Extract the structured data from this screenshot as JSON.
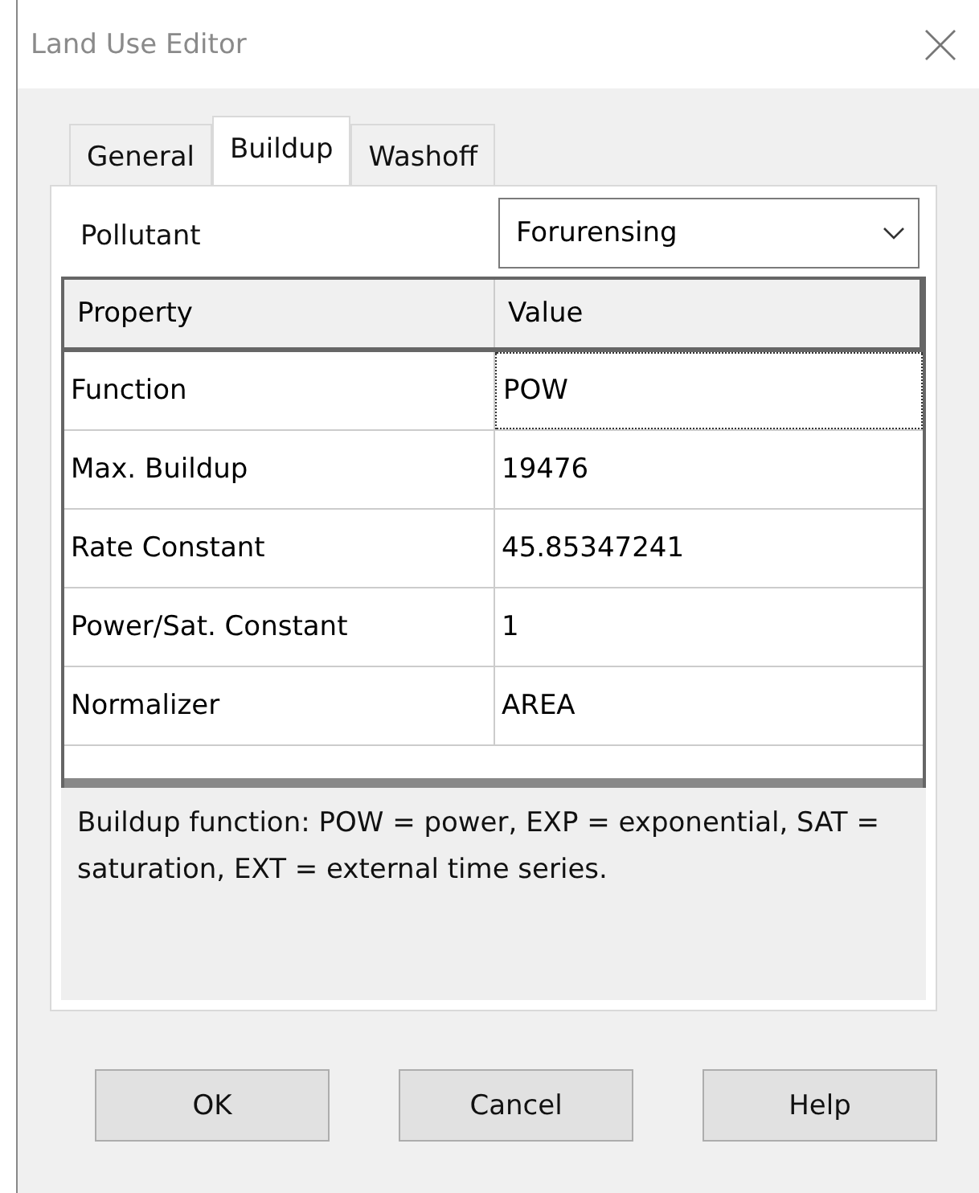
{
  "window": {
    "title": "Land Use Editor"
  },
  "tabs": [
    {
      "label": "General",
      "selected": false
    },
    {
      "label": "Buildup",
      "selected": true
    },
    {
      "label": "Washoff",
      "selected": false
    }
  ],
  "pollutant": {
    "label": "Pollutant",
    "value": "Forurensing"
  },
  "table": {
    "columns": [
      "Property",
      "Value"
    ],
    "rows": [
      {
        "property": "Function",
        "value": "POW",
        "focused": true
      },
      {
        "property": "Max. Buildup",
        "value": "19476",
        "focused": false
      },
      {
        "property": "Rate Constant",
        "value": "45.85347241",
        "focused": false
      },
      {
        "property": "Power/Sat. Constant",
        "value": "1",
        "focused": false
      },
      {
        "property": "Normalizer",
        "value": "AREA",
        "focused": false
      }
    ]
  },
  "description": "Buildup function: POW = power, EXP = exponential, SAT = saturation, EXT = external time series.",
  "buttons": [
    "OK",
    "Cancel",
    "Help"
  ]
}
